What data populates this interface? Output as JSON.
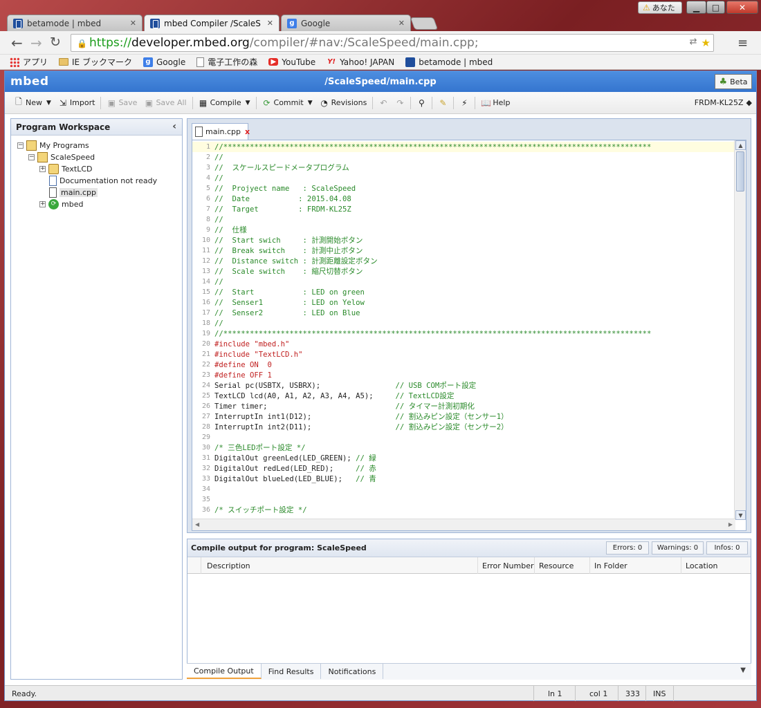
{
  "os": {
    "user_label": "あなた"
  },
  "tabs": [
    {
      "title": "betamode | mbed",
      "icon": "mbed-favicon"
    },
    {
      "title": "mbed Compiler /ScaleS",
      "icon": "mbed-favicon",
      "active": true
    },
    {
      "title": "Google",
      "icon": "google-favicon"
    }
  ],
  "address": {
    "scheme": "https://",
    "host": "developer.mbed.org",
    "path": "/compiler/#nav:/ScaleSpeed/main.cpp;"
  },
  "bookmarks": [
    {
      "label": "アプリ",
      "icon": "apps-icon"
    },
    {
      "label": "IE ブックマーク",
      "icon": "folder-icon"
    },
    {
      "label": "Google",
      "icon": "google-icon"
    },
    {
      "label": "電子工作の森",
      "icon": "page-icon"
    },
    {
      "label": "YouTube",
      "icon": "youtube-icon"
    },
    {
      "label": "Yahoo! JAPAN",
      "icon": "yahoo-icon"
    },
    {
      "label": "betamode | mbed",
      "icon": "mbed-icon"
    }
  ],
  "app": {
    "logo": "mbed",
    "title": "/ScaleSpeed/main.cpp",
    "beta_label": "Beta",
    "device": "FRDM-KL25Z"
  },
  "toolbar": {
    "new": "New",
    "import": "Import",
    "save": "Save",
    "save_all": "Save All",
    "compile": "Compile",
    "commit": "Commit",
    "revisions": "Revisions",
    "help": "Help"
  },
  "workspace": {
    "title": "Program Workspace",
    "tree": {
      "root": "My Programs",
      "program": "ScaleSpeed",
      "lib1": "TextLCD",
      "doc": "Documentation not ready",
      "file": "main.cpp",
      "lib2": "mbed"
    }
  },
  "editor": {
    "tab": "main.cpp",
    "lines": [
      {
        "n": "1",
        "t": "//*************************************************************************************************",
        "k": "c-com"
      },
      {
        "n": "2",
        "t": "//",
        "k": "c-com"
      },
      {
        "n": "3",
        "t": "//  スケールスピードメータプログラム",
        "k": "c-com"
      },
      {
        "n": "4",
        "t": "//",
        "k": "c-com"
      },
      {
        "n": "5",
        "t": "//  Projyect name   : ScaleSpeed",
        "k": "c-com"
      },
      {
        "n": "6",
        "t": "//  Date           : 2015.04.08",
        "k": "c-com"
      },
      {
        "n": "7",
        "t": "//  Target         : FRDM-KL25Z",
        "k": "c-com"
      },
      {
        "n": "8",
        "t": "//",
        "k": "c-com"
      },
      {
        "n": "9",
        "t": "//  仕様",
        "k": "c-com"
      },
      {
        "n": "10",
        "t": "//  Start swich     : 計測開始ボタン",
        "k": "c-com"
      },
      {
        "n": "11",
        "t": "//  Break switch    : 計測中止ボタン",
        "k": "c-com"
      },
      {
        "n": "12",
        "t": "//  Distance switch : 計測距離設定ボタン",
        "k": "c-com"
      },
      {
        "n": "13",
        "t": "//  Scale switch    : 縮尺切替ボタン",
        "k": "c-com"
      },
      {
        "n": "14",
        "t": "//",
        "k": "c-com"
      },
      {
        "n": "15",
        "t": "//  Start           : LED on green",
        "k": "c-com"
      },
      {
        "n": "16",
        "t": "//  Senser1         : LED on Yelow",
        "k": "c-com"
      },
      {
        "n": "17",
        "t": "//  Senser2         : LED on Blue",
        "k": "c-com"
      },
      {
        "n": "18",
        "t": "//",
        "k": "c-com"
      },
      {
        "n": "19",
        "t": "//*************************************************************************************************",
        "k": "c-com"
      },
      {
        "n": "20",
        "t": "#include \"mbed.h\"",
        "k": "c-pre"
      },
      {
        "n": "21",
        "t": "#include \"TextLCD.h\"",
        "k": "c-pre"
      },
      {
        "n": "22",
        "t": "#define ON  0",
        "k": "c-pre"
      },
      {
        "n": "23",
        "t": "#define OFF 1",
        "k": "c-pre"
      },
      {
        "n": "24",
        "t": "Serial pc(USBTX, USBRX);",
        "k": "c-code",
        "c": "                 // USB COMポート設定"
      },
      {
        "n": "25",
        "t": "TextLCD lcd(A0, A1, A2, A3, A4, A5);",
        "k": "c-code",
        "c": "     // TextLCD設定"
      },
      {
        "n": "26",
        "t": "Timer timer;",
        "k": "c-code",
        "c": "                             // タイマー計測初期化"
      },
      {
        "n": "27",
        "t": "InterruptIn int1(D12);",
        "k": "c-code",
        "c": "                   // 割込みピン設定（センサー1）"
      },
      {
        "n": "28",
        "t": "InterruptIn int2(D11);",
        "k": "c-code",
        "c": "                   // 割込みピン設定（センサー2）"
      },
      {
        "n": "29",
        "t": "",
        "k": "c-code"
      },
      {
        "n": "30",
        "t": "/* 三色LEDポート設定 */",
        "k": "c-com"
      },
      {
        "n": "31",
        "t": "DigitalOut greenLed(LED_GREEN);",
        "k": "c-code",
        "c": " // 緑"
      },
      {
        "n": "32",
        "t": "DigitalOut redLed(LED_RED);",
        "k": "c-code",
        "c": "     // 赤"
      },
      {
        "n": "33",
        "t": "DigitalOut blueLed(LED_BLUE);",
        "k": "c-code",
        "c": "   // 青"
      },
      {
        "n": "34",
        "t": "",
        "k": "c-code"
      },
      {
        "n": "35",
        "t": "",
        "k": "c-code"
      },
      {
        "n": "36",
        "t": "/* スイッチポート設定 */",
        "k": "c-com"
      }
    ]
  },
  "output": {
    "title": "Compile output for program: ScaleSpeed",
    "errors": "Errors: 0",
    "warnings": "Warnings: 0",
    "infos": "Infos: 0",
    "columns": [
      "Description",
      "Error Number",
      "Resource",
      "In Folder",
      "Location"
    ],
    "tabs": [
      "Compile Output",
      "Find Results",
      "Notifications"
    ]
  },
  "status": {
    "text": "Ready.",
    "ln": "ln 1",
    "col": "col 1",
    "chars": "333",
    "mode": "INS"
  }
}
